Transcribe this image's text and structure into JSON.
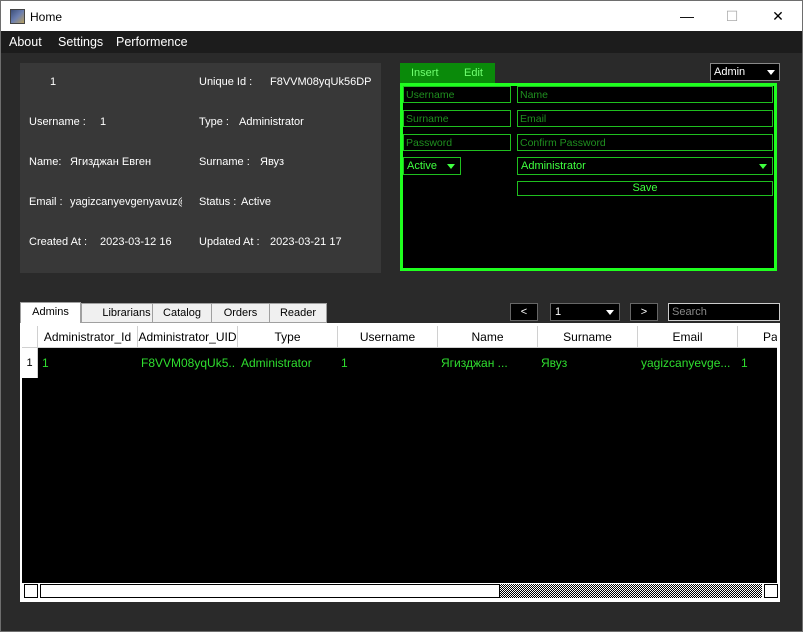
{
  "window": {
    "title": "Home",
    "minimize": "—",
    "maximize": "☐",
    "close": "✕"
  },
  "menu": {
    "about": "About",
    "settings": "Settings",
    "performance": "Performence"
  },
  "info": {
    "id_value": "1",
    "unique_label": "Unique Id :",
    "unique_value": "F8VVM08yqUk56DP",
    "username_label": "Username :",
    "username_value": "1",
    "type_label": "Type :",
    "type_value": "Administrator",
    "name_label": "Name:",
    "name_value": "Ягизджан Евген",
    "surname_label": "Surname :",
    "surname_value": "Явуз",
    "email_label": "Email :",
    "email_value": "yagizcanyevgenyavuz@",
    "status_label": "Status :",
    "status_value": "Active",
    "created_label": "Created At :",
    "created_value": "2023-03-12 16",
    "updated_label": "Updated At :",
    "updated_value": "2023-03-21 17"
  },
  "form_tabs": {
    "insert": "Insert",
    "edit": "Edit"
  },
  "role_select": {
    "selected": "Admin"
  },
  "form": {
    "username_placeholder": "Username",
    "name_placeholder": "Name",
    "surname_placeholder": "Surname",
    "email_placeholder": "Email",
    "password_placeholder": "Password",
    "confirm_placeholder": "Confirm Password",
    "status_selected": "Active",
    "type_selected": "Administrator",
    "save_label": "Save"
  },
  "bottom_tabs": [
    "Admins",
    "Librarians",
    "Catalog",
    "Orders",
    "Reader"
  ],
  "pager": {
    "prev": "<",
    "page": "1",
    "next": ">",
    "search_placeholder": "Search"
  },
  "table": {
    "columns": [
      "Administrator_Id",
      "Administrator_UID",
      "Type",
      "Username",
      "Name",
      "Surname",
      "Email",
      "Pa"
    ],
    "rows": [
      {
        "row_number": "1",
        "cells": [
          "1",
          "F8VVM08yqUk5...",
          "Administrator",
          "1",
          "Ягизджан ...",
          "Явуз",
          "yagizcanyevge...",
          "1"
        ]
      }
    ]
  },
  "colors": {
    "accent_green": "#1fff1f",
    "text_green": "#2fdf2f",
    "tab_green": "#0a8a0a",
    "panel": "#383838",
    "background": "#2a2a2a"
  }
}
